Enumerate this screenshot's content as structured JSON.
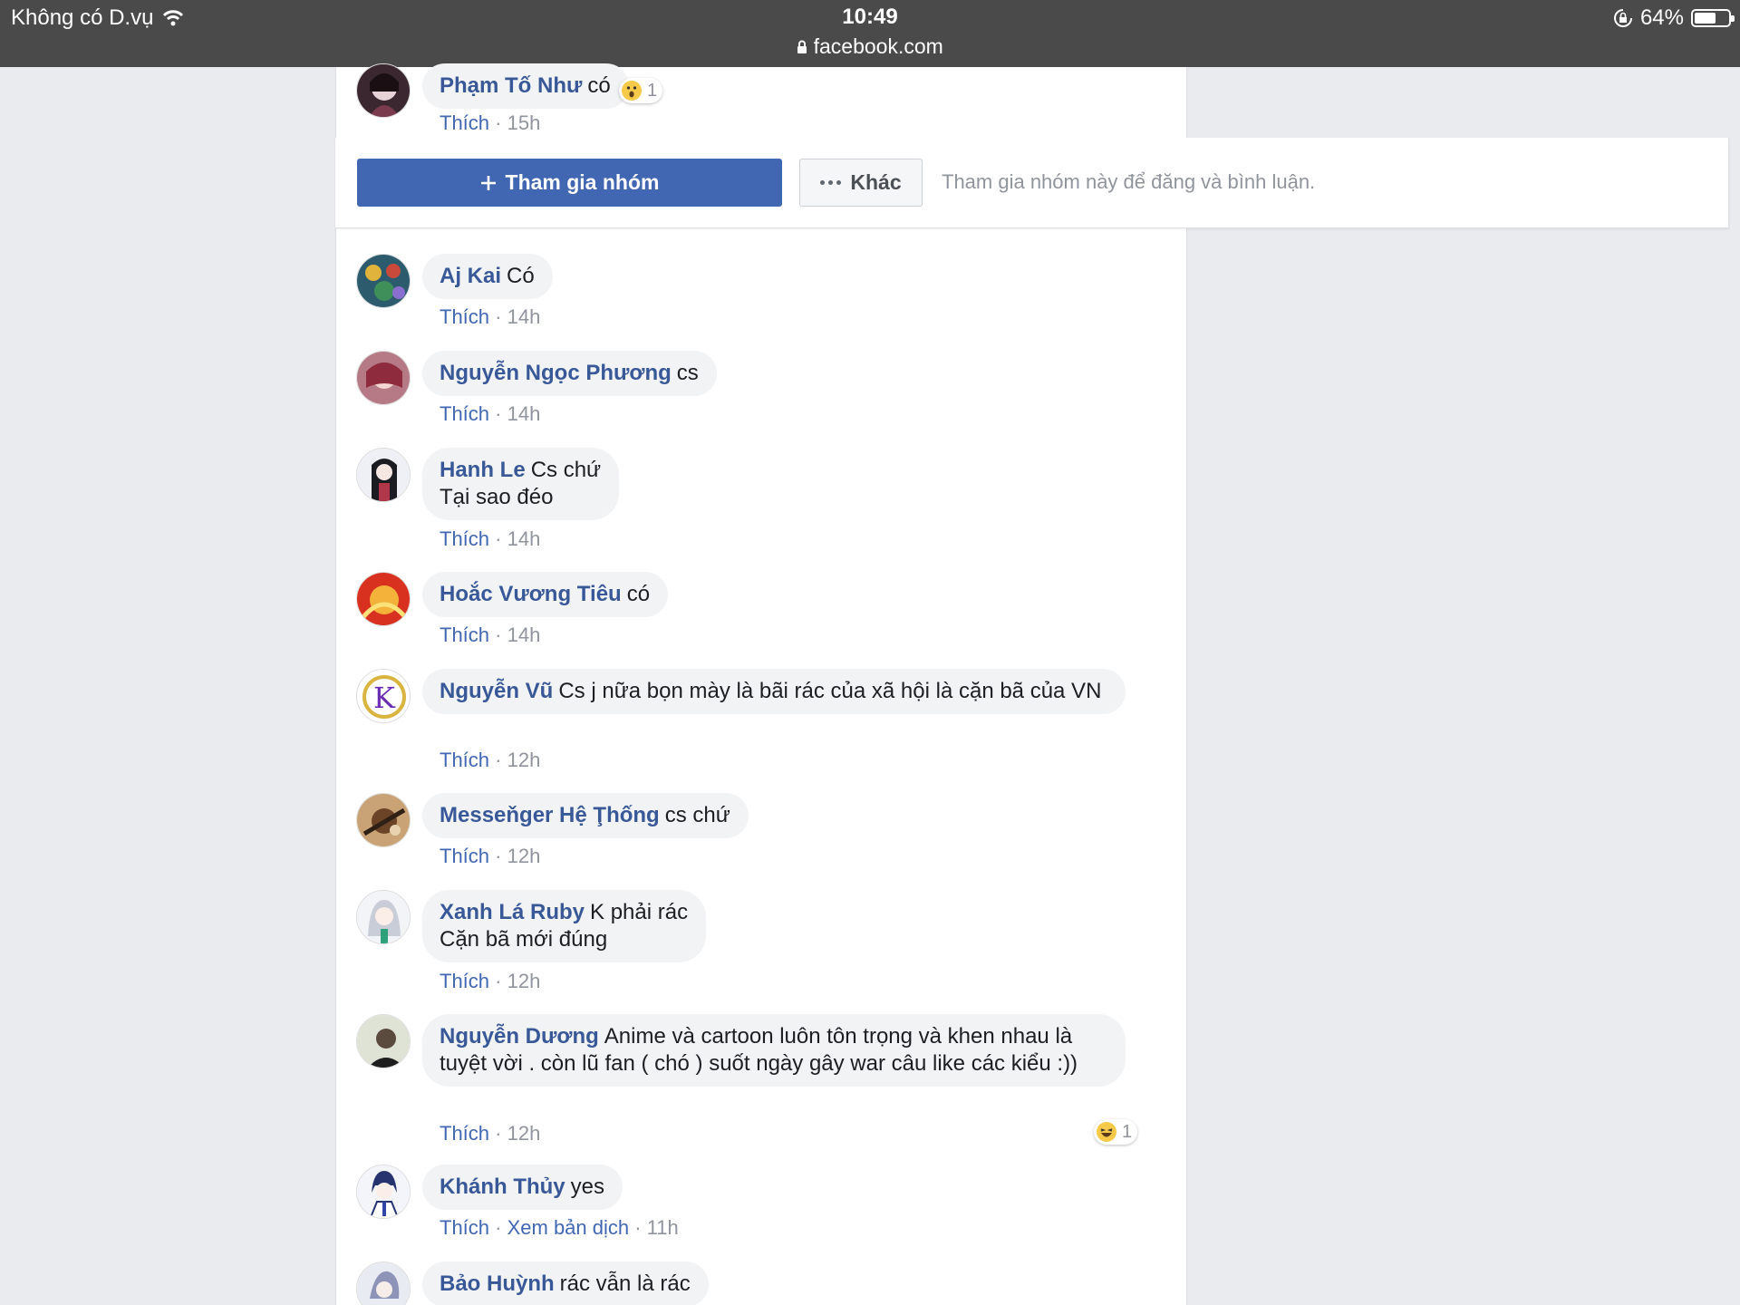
{
  "statusbar": {
    "carrier": "Không có D.vụ",
    "time": "10:49",
    "url": "facebook.com",
    "battery": "64%",
    "battery_level": 0.64
  },
  "join_bar": {
    "join_label": "Tham gia nhóm",
    "more_label": "Khác",
    "hint": "Tham gia nhóm này để đăng và bình luận."
  },
  "like_label": "Thích",
  "translate_label": "Xem bản dịch",
  "comments": [
    {
      "author": "Phạm Tố Như",
      "text": "có",
      "time": "15h",
      "reaction_count": "1"
    },
    {
      "author": "Aj Kai",
      "text": "Có",
      "time": "14h"
    },
    {
      "author": "Nguyễn Ngọc Phương",
      "text": "cs",
      "time": "14h"
    },
    {
      "author": "Hanh Le",
      "text": "Cs chứ",
      "text2": "Tại sao đéo",
      "time": "14h"
    },
    {
      "author": "Hoắc Vương Tiêu",
      "text": "có",
      "time": "14h"
    },
    {
      "author": "Nguyễn Vũ",
      "text": "Cs j nữa bọn mày là bãi rác của xã hội là cặn bã của VN",
      "time": "12h"
    },
    {
      "author": "Messeňger Hệ Ţhống",
      "text": "cs chứ",
      "time": "12h"
    },
    {
      "author": "Xanh Lá Ruby",
      "text": "K phải rác",
      "text2": "Cặn bã mới đúng",
      "time": "12h"
    },
    {
      "author": "Nguyễn Dương",
      "text": "Anime và cartoon luôn tôn trọng và khen nhau là tuyệt vời . còn lũ fan ( chó ) suốt ngày gây war câu like các kiểu :))",
      "time": "12h",
      "reaction_count": "1"
    },
    {
      "author": "Khánh Thủy",
      "text": "yes",
      "time": "11h"
    },
    {
      "author": "Bảo Huỳnh",
      "text": "rác vẫn là rác"
    }
  ],
  "colors": {
    "link": "#385898",
    "brand": "#4267b2",
    "bubble": "#f2f3f5",
    "background": "#e9ebee"
  }
}
